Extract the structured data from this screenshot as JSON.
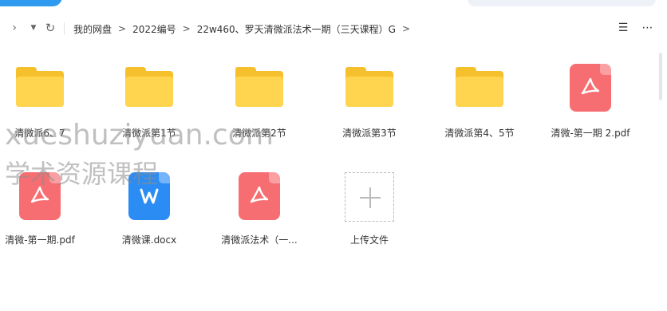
{
  "toolbar": {
    "breadcrumb": [
      "我的网盘",
      "2022编号",
      "22w460、罗天清微派法术一期（三天课程）G"
    ],
    "separator": ">"
  },
  "files": [
    {
      "name": "清微派6、7",
      "type": "folder"
    },
    {
      "name": "清微派第1节",
      "type": "folder"
    },
    {
      "name": "清微派第2节",
      "type": "folder"
    },
    {
      "name": "清微派第3节",
      "type": "folder"
    },
    {
      "name": "清微派第4、5节",
      "type": "folder"
    },
    {
      "name": "清微-第一期 2.pdf",
      "type": "pdf"
    },
    {
      "name": "清微-第一期.pdf",
      "type": "pdf"
    },
    {
      "name": "清微课.docx",
      "type": "docx"
    },
    {
      "name": "清微派法术（一...",
      "type": "pdf"
    }
  ],
  "upload": {
    "label": "上传文件"
  },
  "watermark": {
    "line1": "xueshuziyuan.com",
    "line2": "学术资源课程"
  },
  "colors": {
    "folder": "#ffd54f",
    "pdf": "#f76e72",
    "word": "#2b8cf4",
    "accent": "#2e9bf0"
  }
}
